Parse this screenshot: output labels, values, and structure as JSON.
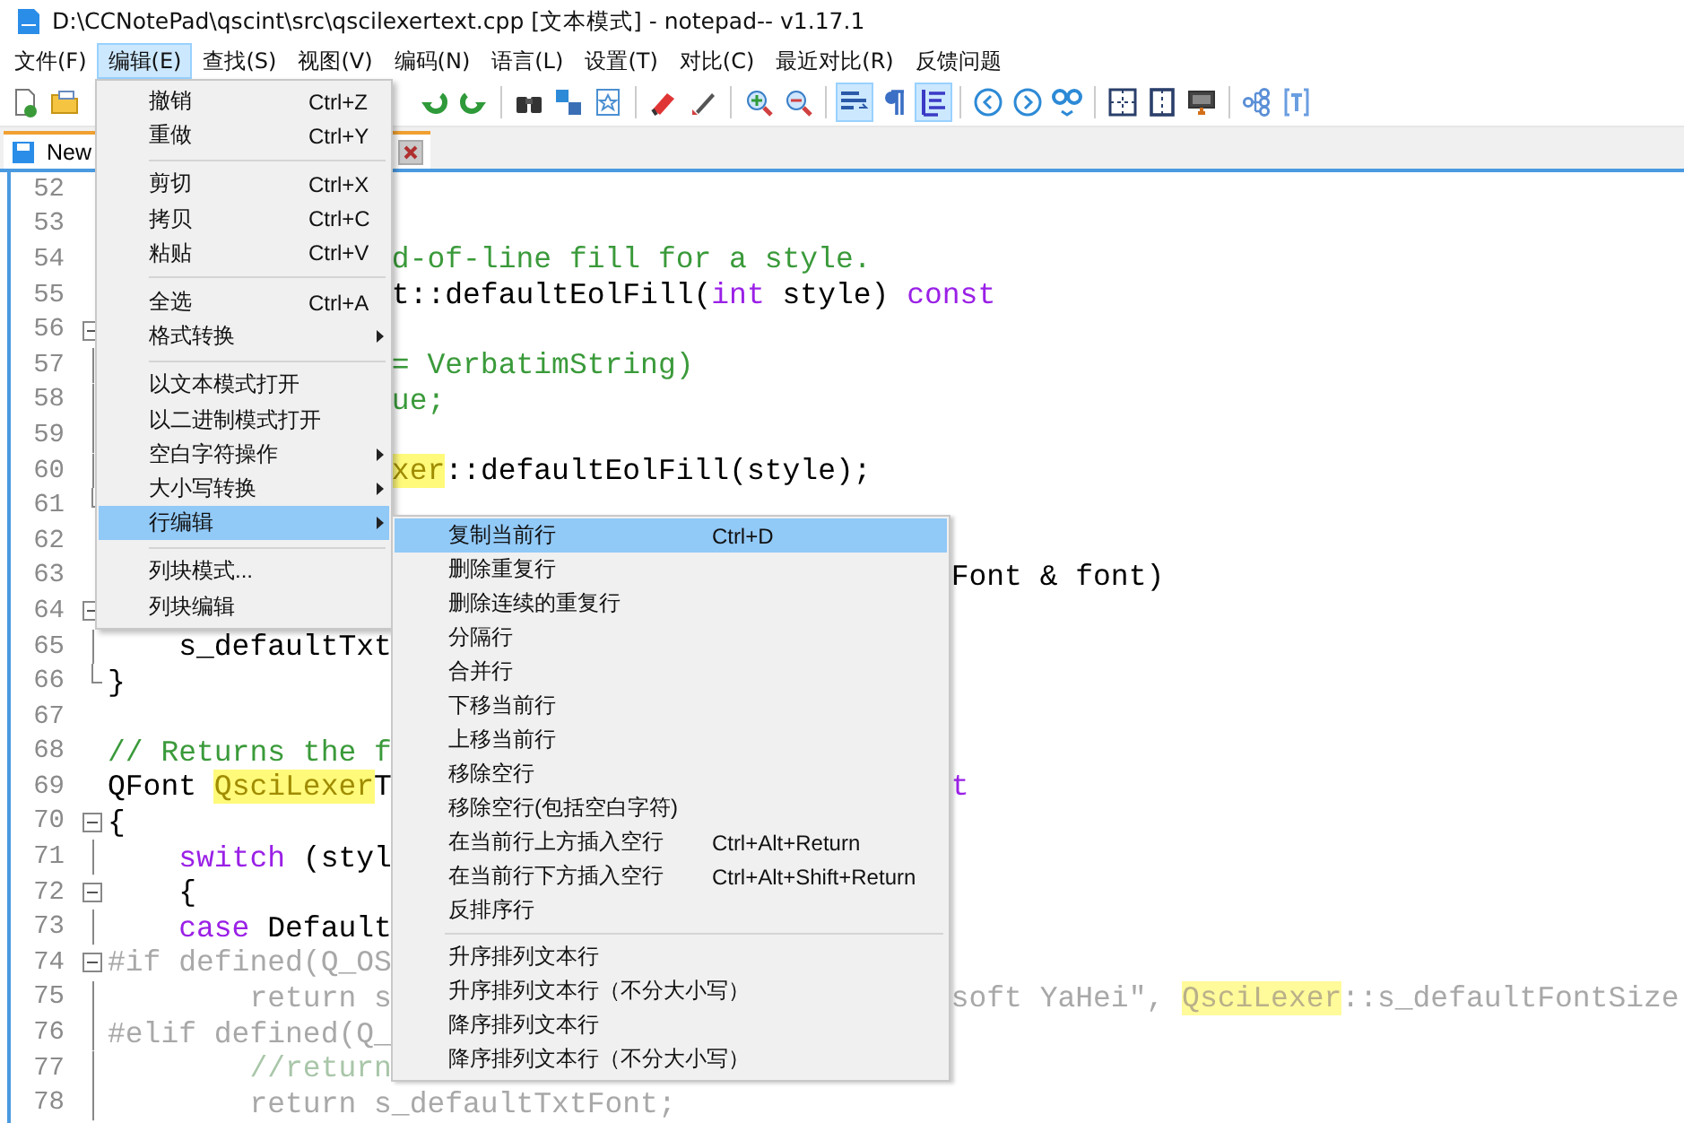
{
  "window": {
    "title": "D:\\CCNotePad\\qscint\\src\\qscilexertext.cpp [文本模式] - notepad-- v1.17.1"
  },
  "menu_bar": [
    {
      "label": "文件(F)",
      "selected": false
    },
    {
      "label": "编辑(E)",
      "selected": true
    },
    {
      "label": "查找(S)",
      "selected": false
    },
    {
      "label": "视图(V)",
      "selected": false
    },
    {
      "label": "编码(N)",
      "selected": false
    },
    {
      "label": "语言(L)",
      "selected": false
    },
    {
      "label": "设置(T)",
      "selected": false
    },
    {
      "label": "对比(C)",
      "selected": false
    },
    {
      "label": "最近对比(R)",
      "selected": false
    },
    {
      "label": "反馈问题",
      "selected": false
    }
  ],
  "toolbar": [
    {
      "selected": false
    },
    {
      "selected": false
    },
    {
      "selected": false
    },
    {
      "selected": false
    },
    {
      "selected": false
    },
    {
      "selected": false
    },
    {
      "selected": false
    },
    {
      "selected": false
    },
    {
      "selected": false
    },
    {
      "selected": false
    },
    {
      "selected": false
    },
    {
      "selected": true
    },
    {
      "selected": false
    },
    {
      "selected": true
    },
    {
      "selected": false
    },
    {
      "selected": false
    },
    {
      "selected": false
    },
    {
      "selected": false
    },
    {
      "selected": false
    },
    {
      "selected": false
    },
    {
      "selected": false
    },
    {
      "selected": false
    }
  ],
  "tabs": [
    {
      "label": "New",
      "selected": true
    }
  ],
  "editor": {
    "lines": [
      {
        "number": "52",
        "kind": "plain"
      },
      {
        "number": "53",
        "kind": "plain"
      },
      {
        "number": "54",
        "kind": "plain",
        "mid": [
          {
            "text": "d-of-line fill for a style.",
            "kind": "comment"
          }
        ]
      },
      {
        "number": "55",
        "kind": "plain",
        "mid": [
          {
            "text": "t::defaultEolFill(",
            "kind": "plain"
          },
          {
            "text": "int",
            "kind": "keyword"
          },
          {
            "text": " style) ",
            "kind": "plain"
          },
          {
            "text": "const",
            "kind": "keyword"
          }
        ]
      },
      {
        "number": "56",
        "kind": "fold-start"
      },
      {
        "number": "57",
        "kind": "fold-body",
        "mid": [
          {
            "text": "= VerbatimString)",
            "kind": "literal"
          }
        ]
      },
      {
        "number": "58",
        "kind": "fold-body",
        "mid": [
          {
            "text": "ue;",
            "kind": "literal"
          }
        ]
      },
      {
        "number": "59",
        "kind": "fold-body"
      },
      {
        "number": "60",
        "kind": "fold-body",
        "mid": [
          {
            "text": "xer",
            "kind": "highlight"
          },
          {
            "text": "::defaultEolFill(style);",
            "kind": "plain"
          }
        ]
      },
      {
        "number": "61",
        "kind": "fold-end"
      },
      {
        "number": "62",
        "kind": "plain"
      },
      {
        "number": "63",
        "kind": "plain",
        "right": [
          {
            "text": "Font & font)",
            "kind": "plain"
          }
        ]
      },
      {
        "number": "64",
        "kind": "fold-start"
      },
      {
        "number": "65",
        "kind": "fold-body",
        "left": [
          {
            "text": "    s_defaultTxt",
            "kind": "plain"
          }
        ]
      },
      {
        "number": "66",
        "kind": "fold-end",
        "left": [
          {
            "text": "}",
            "kind": "plain"
          }
        ]
      },
      {
        "number": "67",
        "kind": "plain"
      },
      {
        "number": "68",
        "kind": "plain",
        "left": [
          {
            "text": "// Returns the f",
            "kind": "comment"
          }
        ]
      },
      {
        "number": "69",
        "kind": "plain",
        "left": [
          {
            "text": "QFont ",
            "kind": "plain"
          },
          {
            "text": "QsciLexer",
            "kind": "highlight"
          },
          {
            "text": "T",
            "kind": "plain"
          }
        ],
        "right": [
          {
            "text": "t",
            "kind": "keyword"
          }
        ]
      },
      {
        "number": "70",
        "kind": "fold-start",
        "left": [
          {
            "text": "{",
            "kind": "plain"
          }
        ]
      },
      {
        "number": "71",
        "kind": "fold-body",
        "left": [
          {
            "text": "    switch",
            "kind": "keyword"
          },
          {
            "text": " (styl",
            "kind": "plain"
          }
        ]
      },
      {
        "number": "72",
        "kind": "fold-start",
        "left": [
          {
            "text": "    {",
            "kind": "plain"
          }
        ]
      },
      {
        "number": "73",
        "kind": "fold-body",
        "left": [
          {
            "text": "    case",
            "kind": "keyword"
          },
          {
            "text": " Default",
            "kind": "plain"
          }
        ]
      },
      {
        "number": "74",
        "kind": "fold-start",
        "left": [
          {
            "text": "#if defined(Q_OS",
            "kind": "inactive"
          }
        ]
      },
      {
        "number": "75",
        "kind": "fold-body",
        "left": [
          {
            "text": "        return s",
            "kind": "inactive"
          }
        ],
        "right": [
          {
            "text": "soft YaHei\", ",
            "kind": "inactive"
          },
          {
            "text": "QsciLexer",
            "kind": "highlight-inactive"
          },
          {
            "text": "::s_defaultFontSize",
            "kind": "inactive"
          }
        ]
      },
      {
        "number": "76",
        "kind": "fold-body",
        "left": [
          {
            "text": "#elif defined(Q_",
            "kind": "inactive"
          }
        ]
      },
      {
        "number": "77",
        "kind": "fold-body",
        "left": [
          {
            "text": "        //return",
            "kind": "inactive-comment"
          }
        ]
      },
      {
        "number": "78",
        "kind": "fold-body",
        "left": [
          {
            "text": "        return s_defaultTxtFont;",
            "kind": "inactive"
          }
        ]
      }
    ]
  },
  "edit_menu": {
    "items": [
      {
        "kind": "item",
        "label": "撤销",
        "shortcut": "Ctrl+Z",
        "submenu": false,
        "selected": false
      },
      {
        "kind": "item",
        "label": "重做",
        "shortcut": "Ctrl+Y",
        "submenu": false,
        "selected": false
      },
      {
        "kind": "separator"
      },
      {
        "kind": "item",
        "label": "剪切",
        "shortcut": "Ctrl+X",
        "submenu": false,
        "selected": false
      },
      {
        "kind": "item",
        "label": "拷贝",
        "shortcut": "Ctrl+C",
        "submenu": false,
        "selected": false
      },
      {
        "kind": "item",
        "label": "粘贴",
        "shortcut": "Ctrl+V",
        "submenu": false,
        "selected": false
      },
      {
        "kind": "separator"
      },
      {
        "kind": "item",
        "label": "全选",
        "shortcut": "Ctrl+A",
        "submenu": false,
        "selected": false
      },
      {
        "kind": "item",
        "label": "格式转换",
        "submenu": true,
        "selected": false
      },
      {
        "kind": "separator"
      },
      {
        "kind": "item",
        "label": "以文本模式打开",
        "submenu": false,
        "selected": false
      },
      {
        "kind": "item",
        "label": "以二进制模式打开",
        "submenu": false,
        "selected": false
      },
      {
        "kind": "item",
        "label": "空白字符操作",
        "submenu": true,
        "selected": false
      },
      {
        "kind": "item",
        "label": "大小写转换",
        "submenu": true,
        "selected": false
      },
      {
        "kind": "item",
        "label": "行编辑",
        "submenu": true,
        "selected": true
      },
      {
        "kind": "separator"
      },
      {
        "kind": "item",
        "label": "列块模式...",
        "submenu": false,
        "selected": false
      },
      {
        "kind": "item",
        "label": "列块编辑",
        "submenu": false,
        "selected": false
      }
    ]
  },
  "line_edit_submenu": {
    "items": [
      {
        "kind": "item",
        "label": "复制当前行",
        "shortcut": "Ctrl+D",
        "submenu": false,
        "selected": true
      },
      {
        "kind": "item",
        "label": "删除重复行",
        "submenu": false,
        "selected": false
      },
      {
        "kind": "item",
        "label": "删除连续的重复行",
        "submenu": false,
        "selected": false
      },
      {
        "kind": "item",
        "label": "分隔行",
        "submenu": false,
        "selected": false
      },
      {
        "kind": "item",
        "label": "合并行",
        "submenu": false,
        "selected": false
      },
      {
        "kind": "item",
        "label": "下移当前行",
        "submenu": false,
        "selected": false
      },
      {
        "kind": "item",
        "label": "上移当前行",
        "submenu": false,
        "selected": false
      },
      {
        "kind": "item",
        "label": "移除空行",
        "submenu": false,
        "selected": false
      },
      {
        "kind": "item",
        "label": "移除空行(包括空白字符)",
        "submenu": false,
        "selected": false
      },
      {
        "kind": "item",
        "label": "在当前行上方插入空行",
        "shortcut": "Ctrl+Alt+Return",
        "submenu": false,
        "selected": false
      },
      {
        "kind": "item",
        "label": "在当前行下方插入空行",
        "shortcut": "Ctrl+Alt+Shift+Return",
        "submenu": false,
        "selected": false
      },
      {
        "kind": "item",
        "label": "反排序行",
        "submenu": false,
        "selected": false
      },
      {
        "kind": "separator"
      },
      {
        "kind": "item",
        "label": "升序排列文本行",
        "submenu": false,
        "selected": false
      },
      {
        "kind": "item",
        "label": "升序排列文本行（不分大小写）",
        "submenu": false,
        "selected": false
      },
      {
        "kind": "item",
        "label": "降序排列文本行",
        "submenu": false,
        "selected": false
      },
      {
        "kind": "item",
        "label": "降序排列文本行（不分大小写）",
        "submenu": false,
        "selected": false
      }
    ]
  }
}
